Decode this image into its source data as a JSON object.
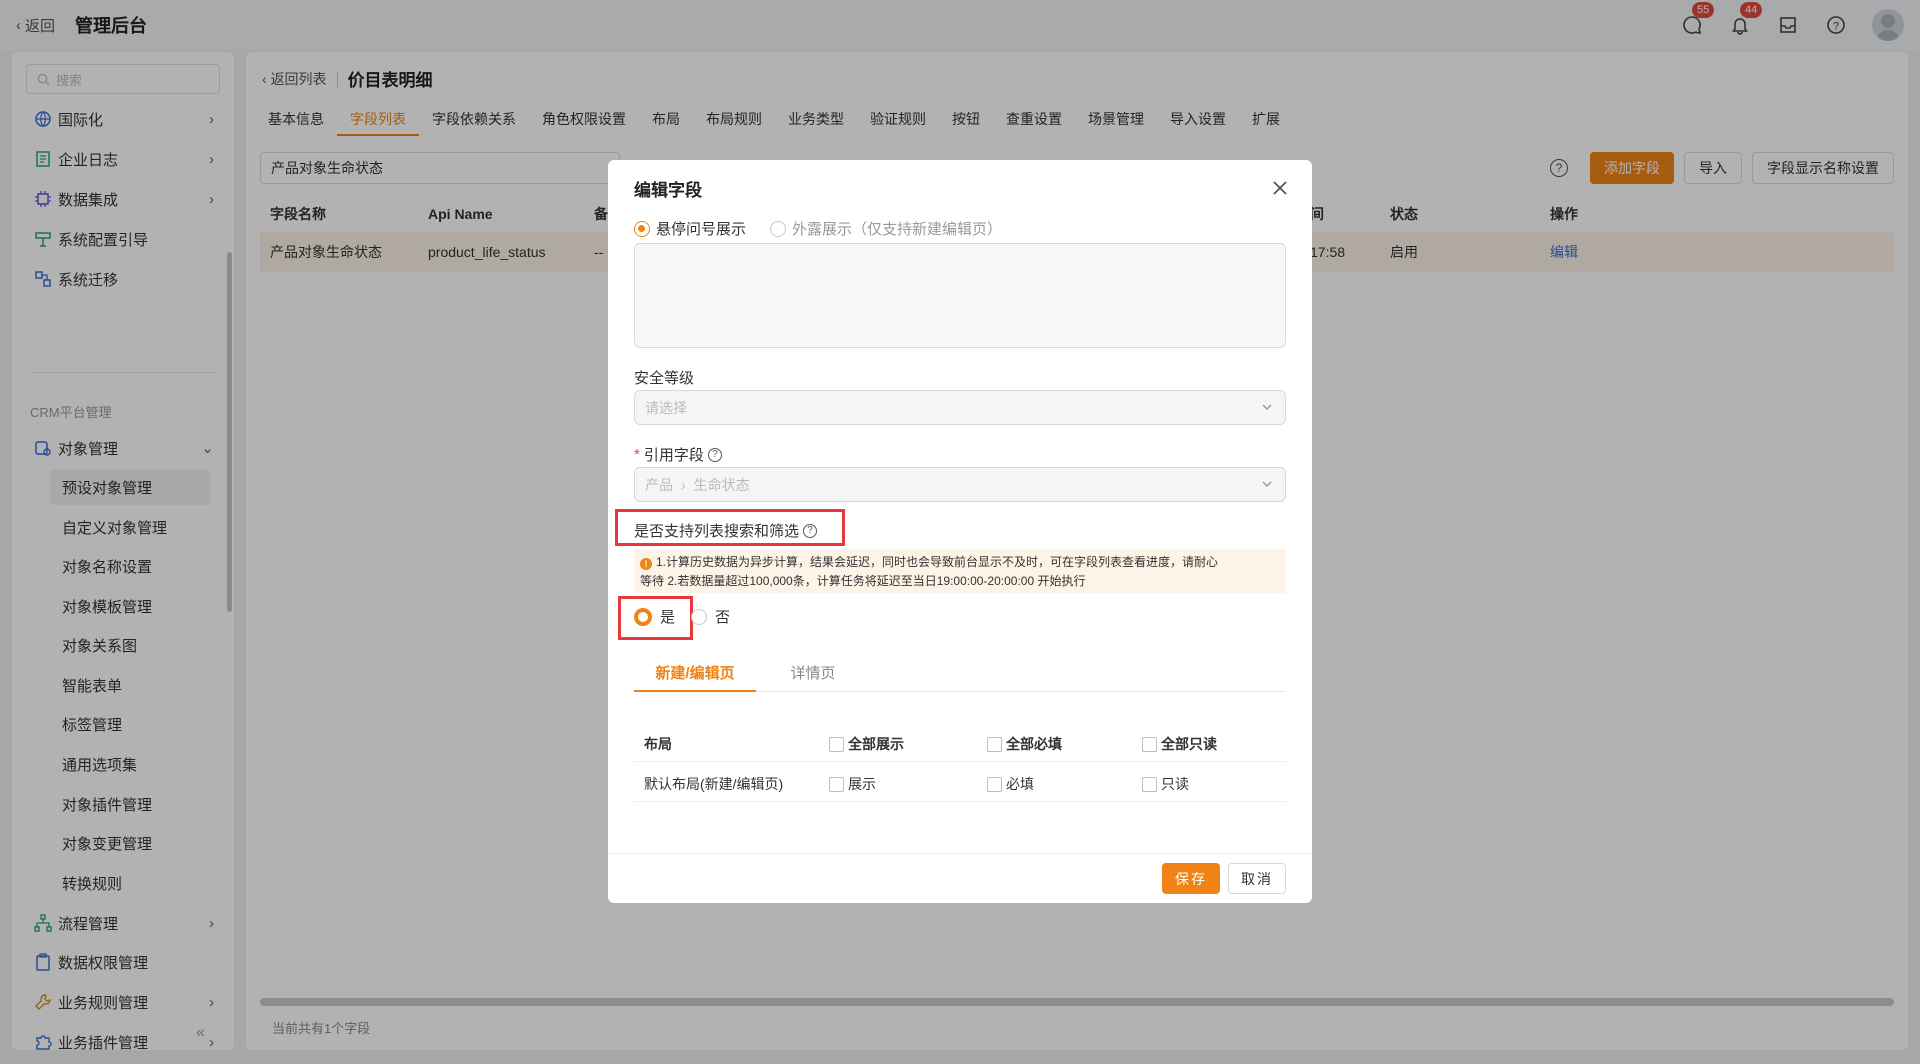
{
  "topbar": {
    "back": "返回",
    "title": "管理后台",
    "chat_badge": "55",
    "bell_badge": "44"
  },
  "sidebar": {
    "search_placeholder": "搜索",
    "items_top": [
      {
        "label": "国际化",
        "icon": "globe-icon"
      },
      {
        "label": "企业日志",
        "icon": "log-icon"
      },
      {
        "label": "数据集成",
        "icon": "chip-icon"
      },
      {
        "label": "系统配置引导",
        "icon": "guide-icon"
      },
      {
        "label": "系统迁移",
        "icon": "migrate-icon"
      }
    ],
    "group_label": "CRM平台管理",
    "object_mgmt": "对象管理",
    "sub_items": [
      "预设对象管理",
      "自定义对象管理",
      "对象名称设置",
      "对象模板管理",
      "对象关系图",
      "智能表单",
      "标签管理",
      "通用选项集",
      "对象插件管理",
      "对象变更管理",
      "转换规则"
    ],
    "items_bottom": [
      {
        "label": "流程管理"
      },
      {
        "label": "数据权限管理"
      },
      {
        "label": "业务规则管理"
      },
      {
        "label": "业务插件管理"
      }
    ]
  },
  "main": {
    "back": "返回列表",
    "title": "价目表明细",
    "tabs": [
      "基本信息",
      "字段列表",
      "字段依赖关系",
      "角色权限设置",
      "布局",
      "布局规则",
      "业务类型",
      "验证规则",
      "按钮",
      "查重设置",
      "场景管理",
      "导入设置",
      "扩展"
    ],
    "active_tab": "字段列表",
    "search_value": "产品对象生命状态",
    "buttons": {
      "add": "添加字段",
      "import": "导入",
      "display_name": "字段显示名称设置"
    },
    "columns": {
      "name": "字段名称",
      "api": "Api Name",
      "remark": "备",
      "time": "间",
      "status": "状态",
      "action": "操作"
    },
    "row": {
      "name": "产品对象生命状态",
      "api": "product_life_status",
      "remark": "--",
      "time": "17:58",
      "status": "启用",
      "action": "编辑"
    },
    "footer": "当前共有1个字段"
  },
  "modal": {
    "title": "编辑字段",
    "help_opt1": "悬停问号展示",
    "help_opt2": "外露展示（仅支持新建编辑页）",
    "security_label": "安全等级",
    "security_placeholder": "请选择",
    "ref_label": "引用字段",
    "ref_part1": "产品",
    "ref_part2": "生命状态",
    "search_filter_label": "是否支持列表搜索和筛选",
    "notice_line1": "1.计算历史数据为异步计算，结果会延迟，同时也会导致前台显示不及时，可在字段列表查看进度，请耐心",
    "notice_line2": "等待  2.若数据量超过100,000条，计算任务将延迟至当日19:00:00-20:00:00 开始执行",
    "yes": "是",
    "no": "否",
    "subtabs": [
      "新建/编辑页",
      "详情页"
    ],
    "perm_header": {
      "layout": "布局",
      "show_all": "全部展示",
      "required_all": "全部必填",
      "readonly_all": "全部只读"
    },
    "perm_row": {
      "layout": "默认布局(新建/编辑页)",
      "show": "展示",
      "required": "必填",
      "readonly": "只读"
    },
    "save": "保存",
    "cancel": "取消"
  },
  "colors": {
    "accent": "#f08315",
    "highlight": "#e8383d"
  }
}
